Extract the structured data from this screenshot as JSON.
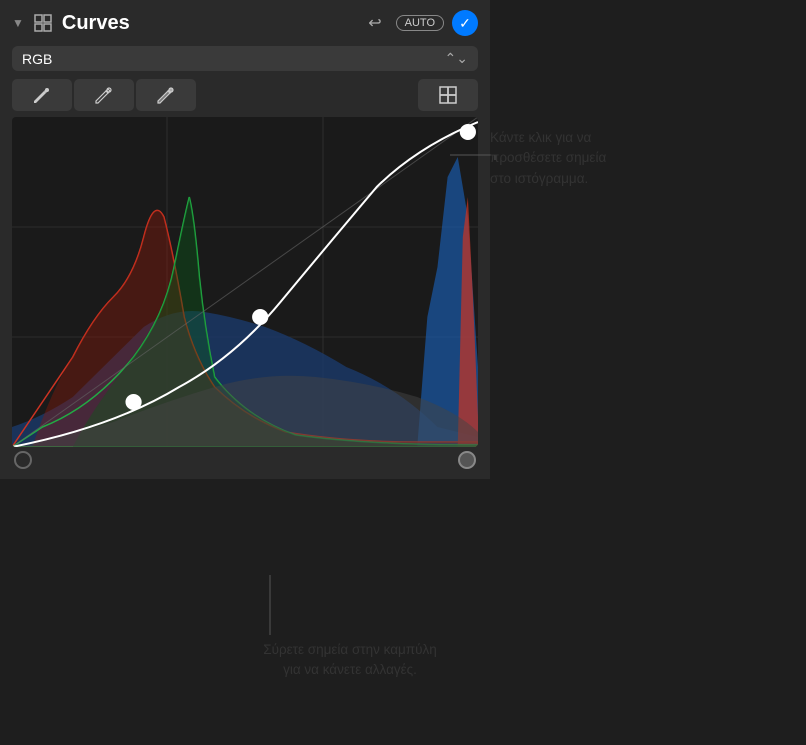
{
  "panel": {
    "title": "Curves",
    "disclosure_label": "▼",
    "undo_label": "↩",
    "auto_label": "AUTO",
    "checkmark_label": "✓",
    "channel": {
      "label": "RGB",
      "chevron": "⌃⌄"
    },
    "tools": [
      {
        "label": "🖊",
        "name": "black-point-eyedropper"
      },
      {
        "label": "🖊",
        "name": "gray-point-eyedropper"
      },
      {
        "label": "🖊",
        "name": "white-point-eyedropper"
      },
      {
        "label": "⊕",
        "name": "add-point-tool"
      }
    ],
    "callout_top": "Κάντε κλικ για να\nπροσθέσετε σημεία\nστο ιστόγραμμα.",
    "callout_bottom": "Σύρετε σημεία στην καμπύλη\nγια να κάνετε αλλαγές."
  }
}
